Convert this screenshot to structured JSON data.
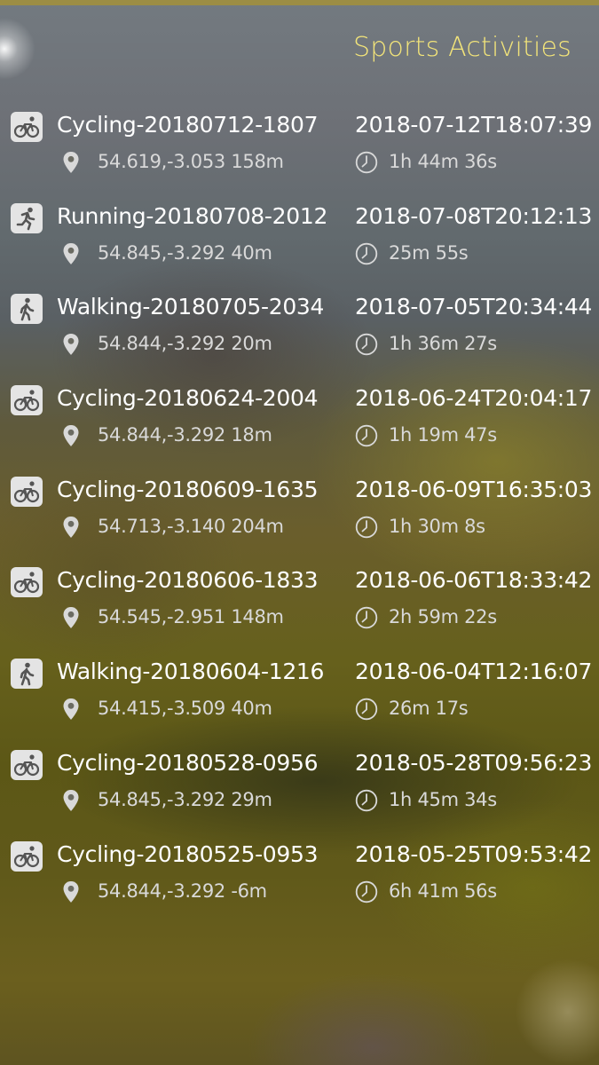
{
  "header": {
    "title": "Sports Activities"
  },
  "activities": [
    {
      "type": "cycling",
      "icon": "bicycle-icon",
      "name": "Cycling-20180712-1807",
      "datetime": "2018-07-12T18:07:39",
      "location": "54.619,-3.053 158m",
      "duration": "1h 44m 36s"
    },
    {
      "type": "running",
      "icon": "running-icon",
      "name": "Running-20180708-2012",
      "datetime": "2018-07-08T20:12:13",
      "location": "54.845,-3.292 40m",
      "duration": "25m 55s"
    },
    {
      "type": "walking",
      "icon": "walking-icon",
      "name": "Walking-20180705-2034",
      "datetime": "2018-07-05T20:34:44",
      "location": "54.844,-3.292 20m",
      "duration": "1h 36m 27s"
    },
    {
      "type": "cycling",
      "icon": "bicycle-icon",
      "name": "Cycling-20180624-2004",
      "datetime": "2018-06-24T20:04:17",
      "location": "54.844,-3.292 18m",
      "duration": "1h 19m 47s"
    },
    {
      "type": "cycling",
      "icon": "bicycle-icon",
      "name": "Cycling-20180609-1635",
      "datetime": "2018-06-09T16:35:03",
      "location": "54.713,-3.140 204m",
      "duration": "1h 30m 8s"
    },
    {
      "type": "cycling",
      "icon": "bicycle-icon",
      "name": "Cycling-20180606-1833",
      "datetime": "2018-06-06T18:33:42",
      "location": "54.545,-2.951 148m",
      "duration": "2h 59m 22s"
    },
    {
      "type": "walking",
      "icon": "walking-icon",
      "name": "Walking-20180604-1216",
      "datetime": "2018-06-04T12:16:07",
      "location": "54.415,-3.509 40m",
      "duration": "26m 17s"
    },
    {
      "type": "cycling",
      "icon": "bicycle-icon",
      "name": "Cycling-20180528-0956",
      "datetime": "2018-05-28T09:56:23",
      "location": "54.845,-3.292 29m",
      "duration": "1h 45m 34s"
    },
    {
      "type": "cycling",
      "icon": "bicycle-icon",
      "name": "Cycling-20180525-0953",
      "datetime": "2018-05-25T09:53:42",
      "location": "54.844,-3.292 -6m",
      "duration": "6h 41m 56s"
    }
  ],
  "colors": {
    "title": "#f2e47a",
    "primary_text": "#ffffff",
    "secondary_text": "#d9d9d9",
    "icon_tile": "#e4e4e4"
  }
}
